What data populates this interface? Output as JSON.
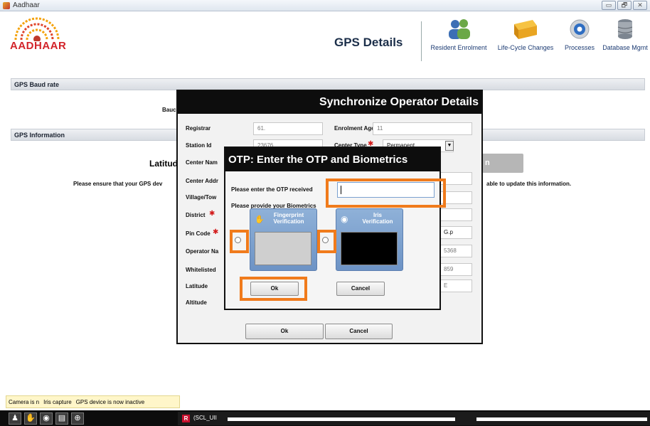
{
  "window": {
    "title": "Aadhaar",
    "controls": [
      "▭",
      "🗗",
      "✕"
    ]
  },
  "header": {
    "logo_text": "AADHAAR",
    "page_title": "GPS Details",
    "nav": [
      {
        "label": "Resident Enrolment",
        "icon": "people-icon"
      },
      {
        "label": "Life-Cycle Changes",
        "icon": "box-icon"
      },
      {
        "label": "Processes",
        "icon": "gear-icon"
      },
      {
        "label": "Database Mgmt",
        "icon": "database-icon"
      }
    ]
  },
  "background": {
    "section_baud": "GPS Baud rate",
    "baud_label": "Bauc",
    "section_info": "GPS Information",
    "latitude_label": "Latitud",
    "ensure_text": "Please ensure that your GPS dev",
    "ensure_text_right": "able to update this information.",
    "button_partial": "n"
  },
  "status_bar": {
    "items": [
      "Camera is n",
      "Iris capture",
      "GPS device is now inactive"
    ]
  },
  "taskbar": {
    "task_label": "(SCL_UII"
  },
  "sync_dialog": {
    "title": "Synchronize Operator Details",
    "fields_left": [
      {
        "label": "Registrar",
        "value": "61.",
        "required": false
      },
      {
        "label": "Station Id",
        "value": "23676",
        "required": false
      },
      {
        "label": "Center Nam",
        "value": "",
        "required": false
      },
      {
        "label": "Center Addr",
        "value": "",
        "required": false
      },
      {
        "label": "Village/Tow",
        "value": "",
        "required": false
      },
      {
        "label": "District",
        "value": "",
        "required": true
      },
      {
        "label": "Pin Code",
        "value": "",
        "required": true
      },
      {
        "label": "Operator Na",
        "value": "",
        "required": false
      },
      {
        "label": "Whitelisted",
        "value": "",
        "required": false
      },
      {
        "label": "Latitude",
        "value": "",
        "required": false
      },
      {
        "label": "Altitude",
        "value": "",
        "required": false
      }
    ],
    "enrolment_agency_label": "Enrolment Agency",
    "enrolment_agency_value": "11",
    "center_type_label": "Center Type",
    "center_type_value": "Permanent",
    "right_partial_values": [
      "G.p",
      "5368",
      "859",
      "E"
    ],
    "ok_label": "Ok",
    "cancel_label": "Cancel"
  },
  "otp_dialog": {
    "title": "OTP: Enter the OTP and Biometrics",
    "otp_label": "Please enter the OTP received",
    "otp_value": "",
    "biometrics_label": "Please provide your Biometrics",
    "fingerprint_label": "Fingerprint Verification",
    "iris_label": "Iris Verification",
    "ok_label": "Ok",
    "cancel_label": "Cancel"
  },
  "colors": {
    "highlight": "#f07b1c",
    "title_bar": "#0d0d0d",
    "brand_red": "#d2232a"
  }
}
